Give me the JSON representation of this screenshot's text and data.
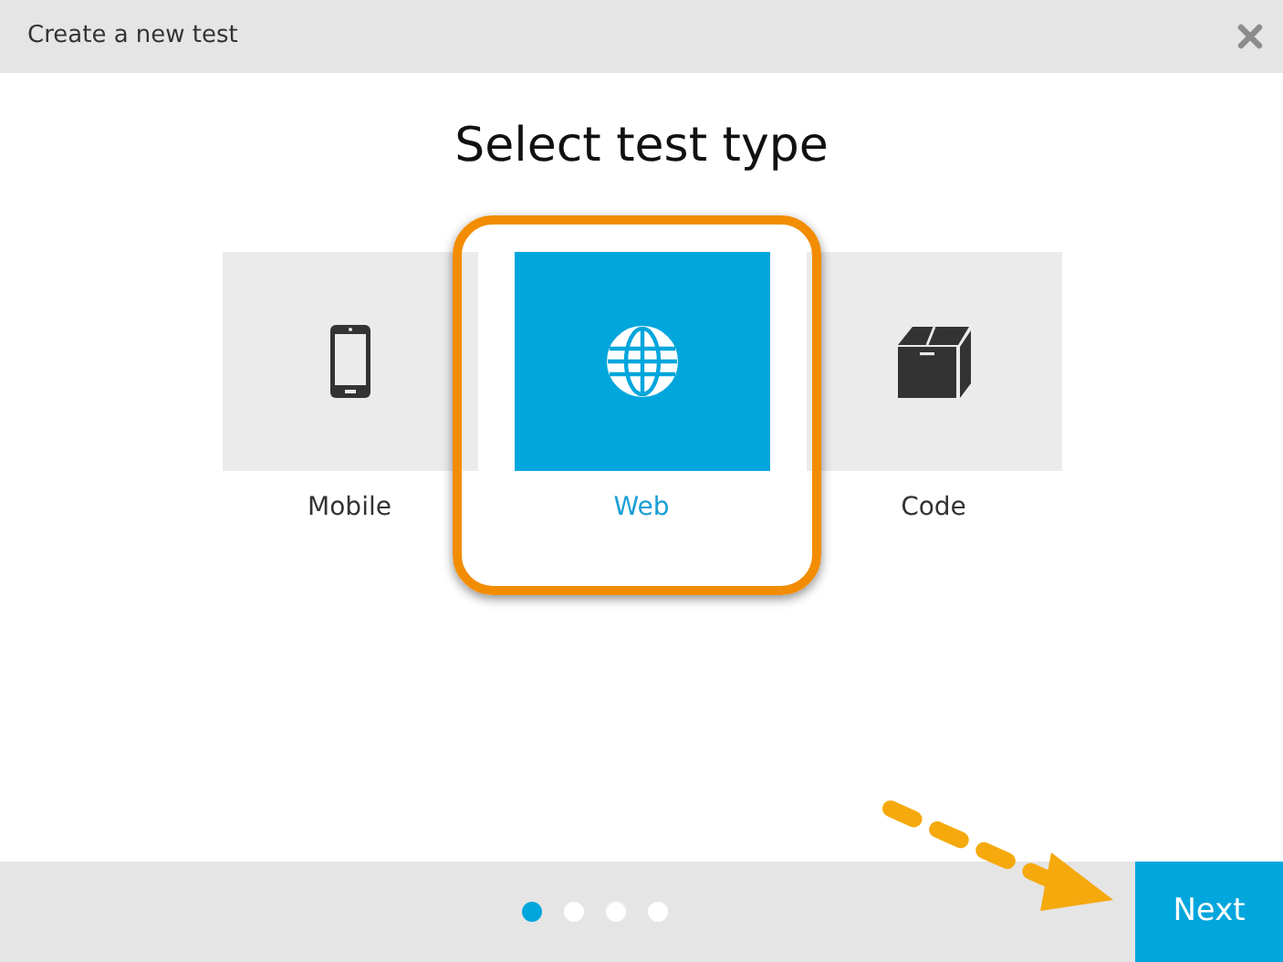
{
  "window": {
    "title": "Create a new test"
  },
  "heading": "Select test type",
  "types": [
    {
      "label": "Mobile",
      "kind": "mobile",
      "selected": false
    },
    {
      "label": "Web",
      "kind": "web",
      "selected": true
    },
    {
      "label": "Code",
      "kind": "code",
      "selected": false
    }
  ],
  "steps": [
    {
      "selected": true
    },
    {
      "selected": false
    },
    {
      "selected": false
    },
    {
      "selected": false
    }
  ],
  "next_button": "Next"
}
